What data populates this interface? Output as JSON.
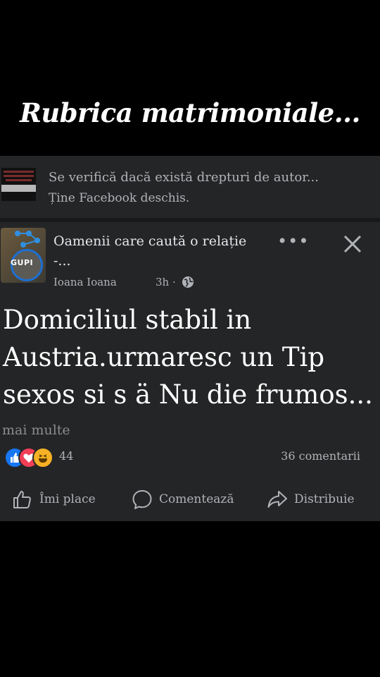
{
  "caption": "Rubrica matrimoniale...",
  "notice": {
    "line1": "Se verifică dacă există drepturi de autor...",
    "line2": "Ține Facebook deschis."
  },
  "post": {
    "avatar_label": "GUPI",
    "group_name": "Oamenii care caută o relație",
    "group_name_cont": "-...",
    "author": "Ioana Ioana",
    "time": "3h ·",
    "text": "Domiciliul stabil in Austria.urmaresc un Tip sexos si s ä Nu die frumos...",
    "more_label": "mai multe",
    "reaction_count": "44",
    "comments": "36 comentarii",
    "actions": {
      "like": "Îmi place",
      "comment": "Comentează",
      "share": "Distribuie"
    }
  },
  "colors": {
    "background": "#000000",
    "card": "#242526",
    "like_blue": "#1877f2",
    "love_red": "#f33e58",
    "haha_yellow": "#f7b125"
  }
}
